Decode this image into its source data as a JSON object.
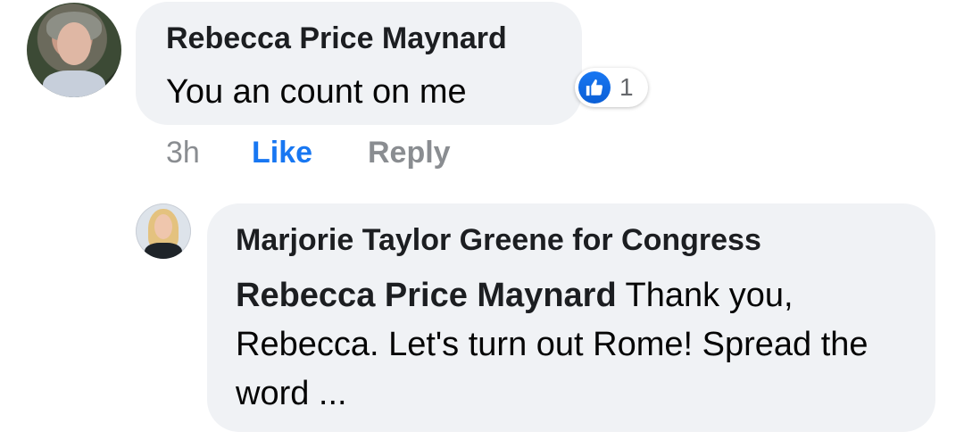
{
  "comment": {
    "author": "Rebecca Price Maynard",
    "text": "You an count on me",
    "reaction_count": "1",
    "reaction_icon": "like-icon",
    "timestamp": "3h",
    "like_label": "Like",
    "reply_label": "Reply"
  },
  "reply": {
    "author": "Marjorie Taylor Greene for Congress",
    "mention": "Rebecca Price Maynard",
    "text": " Thank you, Rebecca. Let's turn out Rome! Spread the word ..."
  },
  "colors": {
    "accent": "#1877f2",
    "bubble": "#f0f2f5",
    "muted": "#8a8d91"
  }
}
